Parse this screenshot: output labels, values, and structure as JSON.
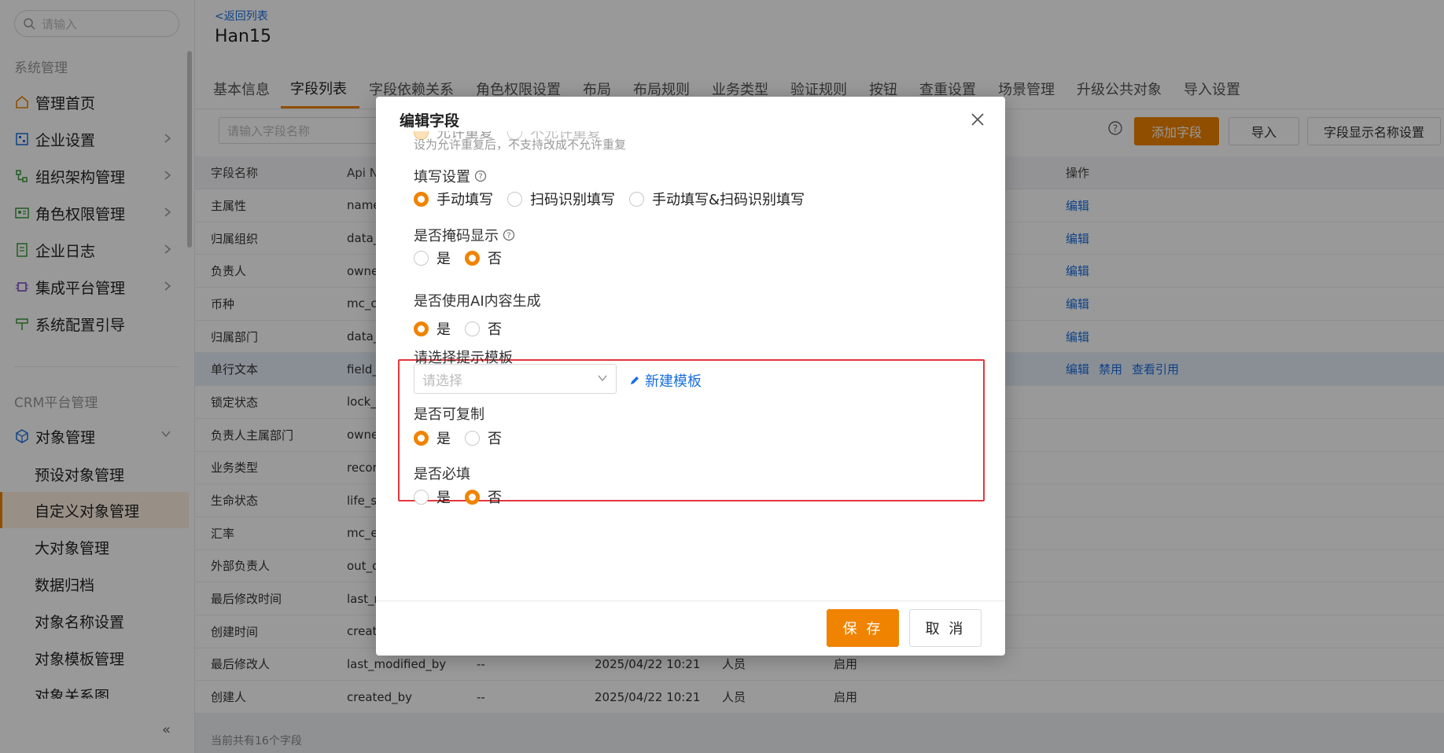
{
  "sidebar": {
    "search_placeholder": "请输入",
    "section_system": "系统管理",
    "items": [
      {
        "label": "管理首页",
        "icon": "home-icon"
      },
      {
        "label": "企业设置",
        "icon": "building-icon"
      },
      {
        "label": "组织架构管理",
        "icon": "org-tree-icon"
      },
      {
        "label": "角色权限管理",
        "icon": "id-card-icon"
      },
      {
        "label": "企业日志",
        "icon": "log-icon"
      },
      {
        "label": "集成平台管理",
        "icon": "chip-icon"
      },
      {
        "label": "系统配置引导",
        "icon": "signpost-icon"
      }
    ],
    "section_crm": "CRM平台管理",
    "object_mgmt": "对象管理",
    "sub_items": [
      "预设对象管理",
      "自定义对象管理",
      "大对象管理",
      "数据归档",
      "对象名称设置",
      "对象模板管理",
      "对象关系图"
    ],
    "collapse": "«"
  },
  "header": {
    "back": "<返回列表",
    "title": "Han15",
    "tabs": [
      "基本信息",
      "字段列表",
      "字段依赖关系",
      "角色权限设置",
      "布局",
      "布局规则",
      "业务类型",
      "验证规则",
      "按钮",
      "查重设置",
      "场景管理",
      "升级公共对象",
      "导入设置"
    ]
  },
  "toolbar": {
    "search_placeholder": "请输入字段名称",
    "add_field": "添加字段",
    "import": "导入",
    "display_setting": "字段显示名称设置"
  },
  "table": {
    "headers": [
      "字段名称",
      "Api N",
      "",
      "",
      "",
      "",
      "操作"
    ],
    "rows": [
      {
        "name": "主属性",
        "api": "name",
        "c3": "",
        "c4": "",
        "c5": "",
        "c6": "",
        "actions": [
          "编辑"
        ]
      },
      {
        "name": "归属组织",
        "api": "data_",
        "c3": "",
        "c4": "",
        "c5": "",
        "c6": "",
        "actions": [
          "编辑"
        ]
      },
      {
        "name": "负责人",
        "api": "owne",
        "c3": "",
        "c4": "",
        "c5": "",
        "c6": "",
        "actions": [
          "编辑"
        ]
      },
      {
        "name": "币种",
        "api": "mc_c",
        "c3": "",
        "c4": "",
        "c5": "",
        "c6": "",
        "actions": [
          "编辑"
        ]
      },
      {
        "name": "归属部门",
        "api": "data_",
        "c3": "",
        "c4": "",
        "c5": "",
        "c6": "",
        "actions": [
          "编辑"
        ]
      },
      {
        "name": "单行文本",
        "api": "field_",
        "c3": "",
        "c4": "",
        "c5": "",
        "c6": "",
        "actions": [
          "编辑",
          "禁用",
          "查看引用"
        ]
      },
      {
        "name": "锁定状态",
        "api": "lock_s",
        "c3": "",
        "c4": "",
        "c5": "",
        "c6": "",
        "actions": []
      },
      {
        "name": "负责人主属部门",
        "api": "owne",
        "c3": "",
        "c4": "",
        "c5": "",
        "c6": "",
        "actions": []
      },
      {
        "name": "业务类型",
        "api": "recor",
        "c3": "",
        "c4": "",
        "c5": "",
        "c6": "",
        "actions": []
      },
      {
        "name": "生命状态",
        "api": "life_st",
        "c3": "",
        "c4": "",
        "c5": "",
        "c6": "",
        "actions": []
      },
      {
        "name": "汇率",
        "api": "mc_e",
        "c3": "",
        "c4": "",
        "c5": "",
        "c6": "",
        "actions": []
      },
      {
        "name": "外部负责人",
        "api": "out_o",
        "c3": "",
        "c4": "",
        "c5": "",
        "c6": "",
        "actions": []
      },
      {
        "name": "最后修改时间",
        "api": "last_r",
        "c3": "",
        "c4": "",
        "c5": "",
        "c6": "",
        "actions": []
      },
      {
        "name": "创建时间",
        "api": "create",
        "c3": "",
        "c4": "",
        "c5": "",
        "c6": "",
        "actions": []
      },
      {
        "name": "最后修改人",
        "api": "last_modified_by",
        "c3": "--",
        "c4": "2025/04/22 10:21",
        "c5": "人员",
        "c6": "启用",
        "actions": []
      },
      {
        "name": "创建人",
        "api": "created_by",
        "c3": "--",
        "c4": "2025/04/22 10:21",
        "c5": "人员",
        "c6": "启用",
        "actions": []
      }
    ],
    "footer": "当前共有16个字段"
  },
  "modal": {
    "title": "编辑字段",
    "cut_opt1": "允许重复",
    "cut_opt2": "不允许重复",
    "dup_hint": "设为允许重复后，不支持改成不允许重复",
    "fill_label": "填写设置",
    "fill_opts": [
      "手动填写",
      "扫码识别填写",
      "手动填写&扫码识别填写"
    ],
    "mask_label": "是否掩码显示",
    "ai_label": "是否使用AI内容生成",
    "tpl_label": "请选择提示模板",
    "tpl_placeholder": "请选择",
    "new_tpl": "新建模板",
    "copy_label": "是否可复制",
    "required_label": "是否必填",
    "yes": "是",
    "no": "否",
    "save": "保 存",
    "cancel": "取 消"
  },
  "colors": {
    "accent": "#f08300",
    "link": "#1a6fe0",
    "highlight": "#e3363d"
  }
}
